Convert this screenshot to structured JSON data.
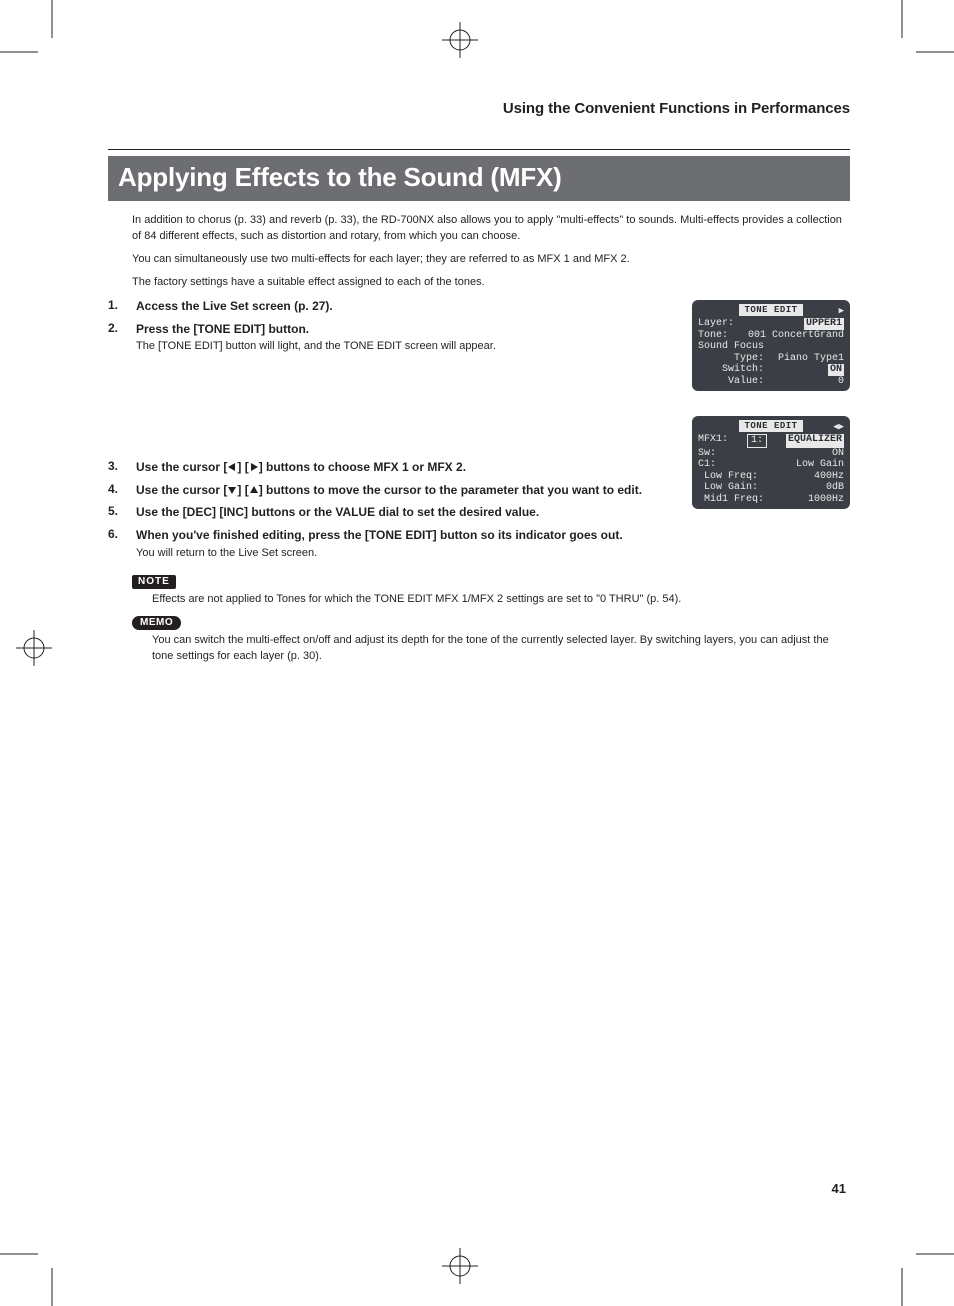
{
  "breadcrumb": "Using the Convenient Functions in Performances",
  "h1": "Applying Effects to the Sound (MFX)",
  "intro": [
    "In addition to chorus (p. 33) and reverb (p. 33), the RD-700NX also allows you to apply \"multi-effects\" to sounds. Multi-effects provides a collection of 84 different effects, such as distortion and rotary, from which you can choose.",
    "You can simultaneously use two multi-effects for each layer; they are referred to as MFX 1 and MFX 2.",
    "The factory settings have a suitable effect assigned to each of the tones."
  ],
  "steps": [
    {
      "n": "1.",
      "t": "Access the Live Set screen (p. 27)."
    },
    {
      "n": "2.",
      "t": "Press the [TONE EDIT] button.",
      "s": "The [TONE EDIT] button will light, and the TONE EDIT screen will appear."
    },
    {
      "n": "3.",
      "pre": "Use the cursor [",
      "mid": "] [",
      "post": "] buttons to choose MFX 1 or MFX 2.",
      "dir": "lr"
    },
    {
      "n": "4.",
      "pre": "Use the cursor [",
      "mid": "] [",
      "post": "] buttons to move the cursor to the parameter that you want to edit.",
      "dir": "du"
    },
    {
      "n": "5.",
      "t": "Use the [DEC] [INC] buttons or the VALUE dial to set the desired value."
    },
    {
      "n": "6.",
      "t": "When you've finished editing, press the [TONE EDIT] button so its indicator goes out.",
      "s": "You will return to the Live Set screen."
    }
  ],
  "note_label": "NOTE",
  "note_text": "Effects are not applied to Tones for which the TONE EDIT MFX 1/MFX 2 settings are set to \"0 THRU\" (p. 54).",
  "memo_label": "MEMO",
  "memo_text": "You can switch the multi-effect on/off and adjust its depth for the tone of the currently selected layer. By switching layers, you can adjust the tone settings for each layer (p. 30).",
  "lcd1": {
    "title": "TONE EDIT",
    "rows": [
      [
        "Layer:",
        "UPPER1"
      ],
      [
        "Tone:",
        "001 ConcertGrand"
      ],
      [
        "Sound Focus",
        ""
      ],
      [
        "      Type:",
        "Piano Type1"
      ],
      [
        "    Switch:",
        "ON"
      ],
      [
        "     Value:",
        "0"
      ]
    ],
    "arrow": "▶"
  },
  "lcd2": {
    "title": "TONE EDIT",
    "rows": [
      [
        "MFX1:",
        "1:",
        "EQUALIZER"
      ],
      [
        "Sw:",
        "",
        "ON"
      ],
      [
        "C1:",
        "",
        "Low Gain"
      ],
      [
        " Low Freq:",
        "",
        "400Hz"
      ],
      [
        " Low Gain:",
        "",
        "0dB"
      ],
      [
        " Mid1 Freq:",
        "",
        "1000Hz"
      ]
    ],
    "arrow": "◀▶"
  },
  "page_num": "41"
}
